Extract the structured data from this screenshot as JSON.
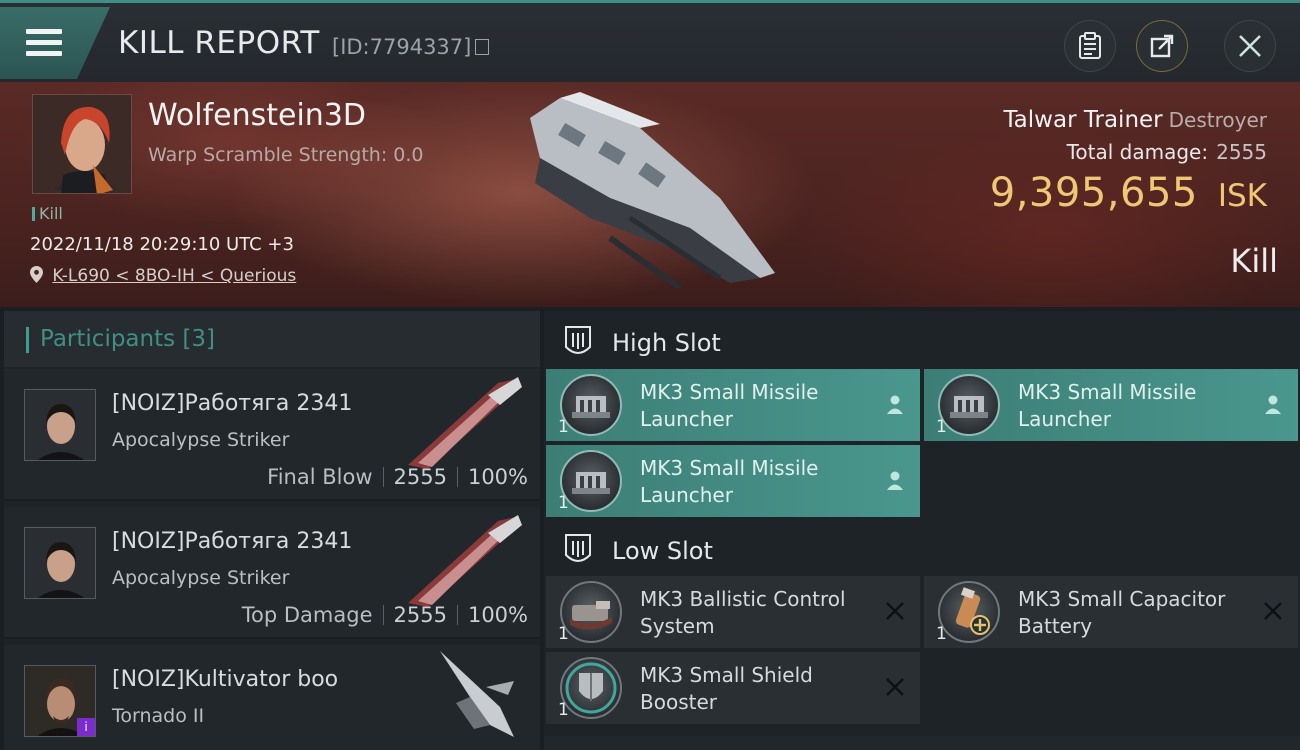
{
  "header": {
    "title": "KILL REPORT",
    "report_id": "[ID:7794337]",
    "buttons": [
      "clipboard-icon",
      "share-icon",
      "close-icon"
    ]
  },
  "victim": {
    "pilot_name": "Wolfenstein3D",
    "warp_scramble": "Warp Scramble Strength: 0.0",
    "kill_tag": "Kill",
    "datetime": "2022/11/18 20:29:10 UTC +3",
    "location": "K-L690 < 8BO-IH < Querious",
    "ship_name": "Talwar Trainer",
    "ship_class": "Destroyer",
    "total_damage_label": "Total damage:",
    "total_damage_value": "2555",
    "isk_amount": "9,395,655",
    "isk_unit": "ISK",
    "result": "Kill"
  },
  "participants": {
    "title": "Participants",
    "count": "[3]",
    "rows": [
      {
        "name": "[NOIZ]Работяга 2341",
        "ship": "Apocalypse Striker",
        "label": "Final Blow",
        "damage": "2555",
        "percent": "100%"
      },
      {
        "name": "[NOIZ]Работяга 2341",
        "ship": "Apocalypse Striker",
        "label": "Top Damage",
        "damage": "2555",
        "percent": "100%"
      },
      {
        "name": "[NOIZ]Kultivator boo",
        "ship": "Tornado II",
        "badge": "i"
      }
    ]
  },
  "fittings": {
    "high_slot": {
      "title": "High Slot",
      "modules": [
        {
          "name": "MK3 Small Missile Launcher",
          "qty": "1",
          "status": "person-icon"
        },
        {
          "name": "MK3 Small Missile Launcher",
          "qty": "1",
          "status": "person-icon"
        },
        {
          "name": "MK3 Small Missile Launcher",
          "qty": "1",
          "status": "person-icon"
        }
      ]
    },
    "low_slot": {
      "title": "Low Slot",
      "modules": [
        {
          "name": "MK3 Ballistic Control System",
          "qty": "1",
          "status": "destroyed-x-icon"
        },
        {
          "name": "MK3 Small Capacitor Battery",
          "qty": "1",
          "status": "destroyed-x-icon"
        },
        {
          "name": "MK3 Small Shield Booster",
          "qty": "1",
          "status": "destroyed-x-icon"
        }
      ]
    }
  },
  "colors": {
    "accent": "#3f9c8e",
    "isk": "#f0c776",
    "active_module": "#4a978d"
  }
}
